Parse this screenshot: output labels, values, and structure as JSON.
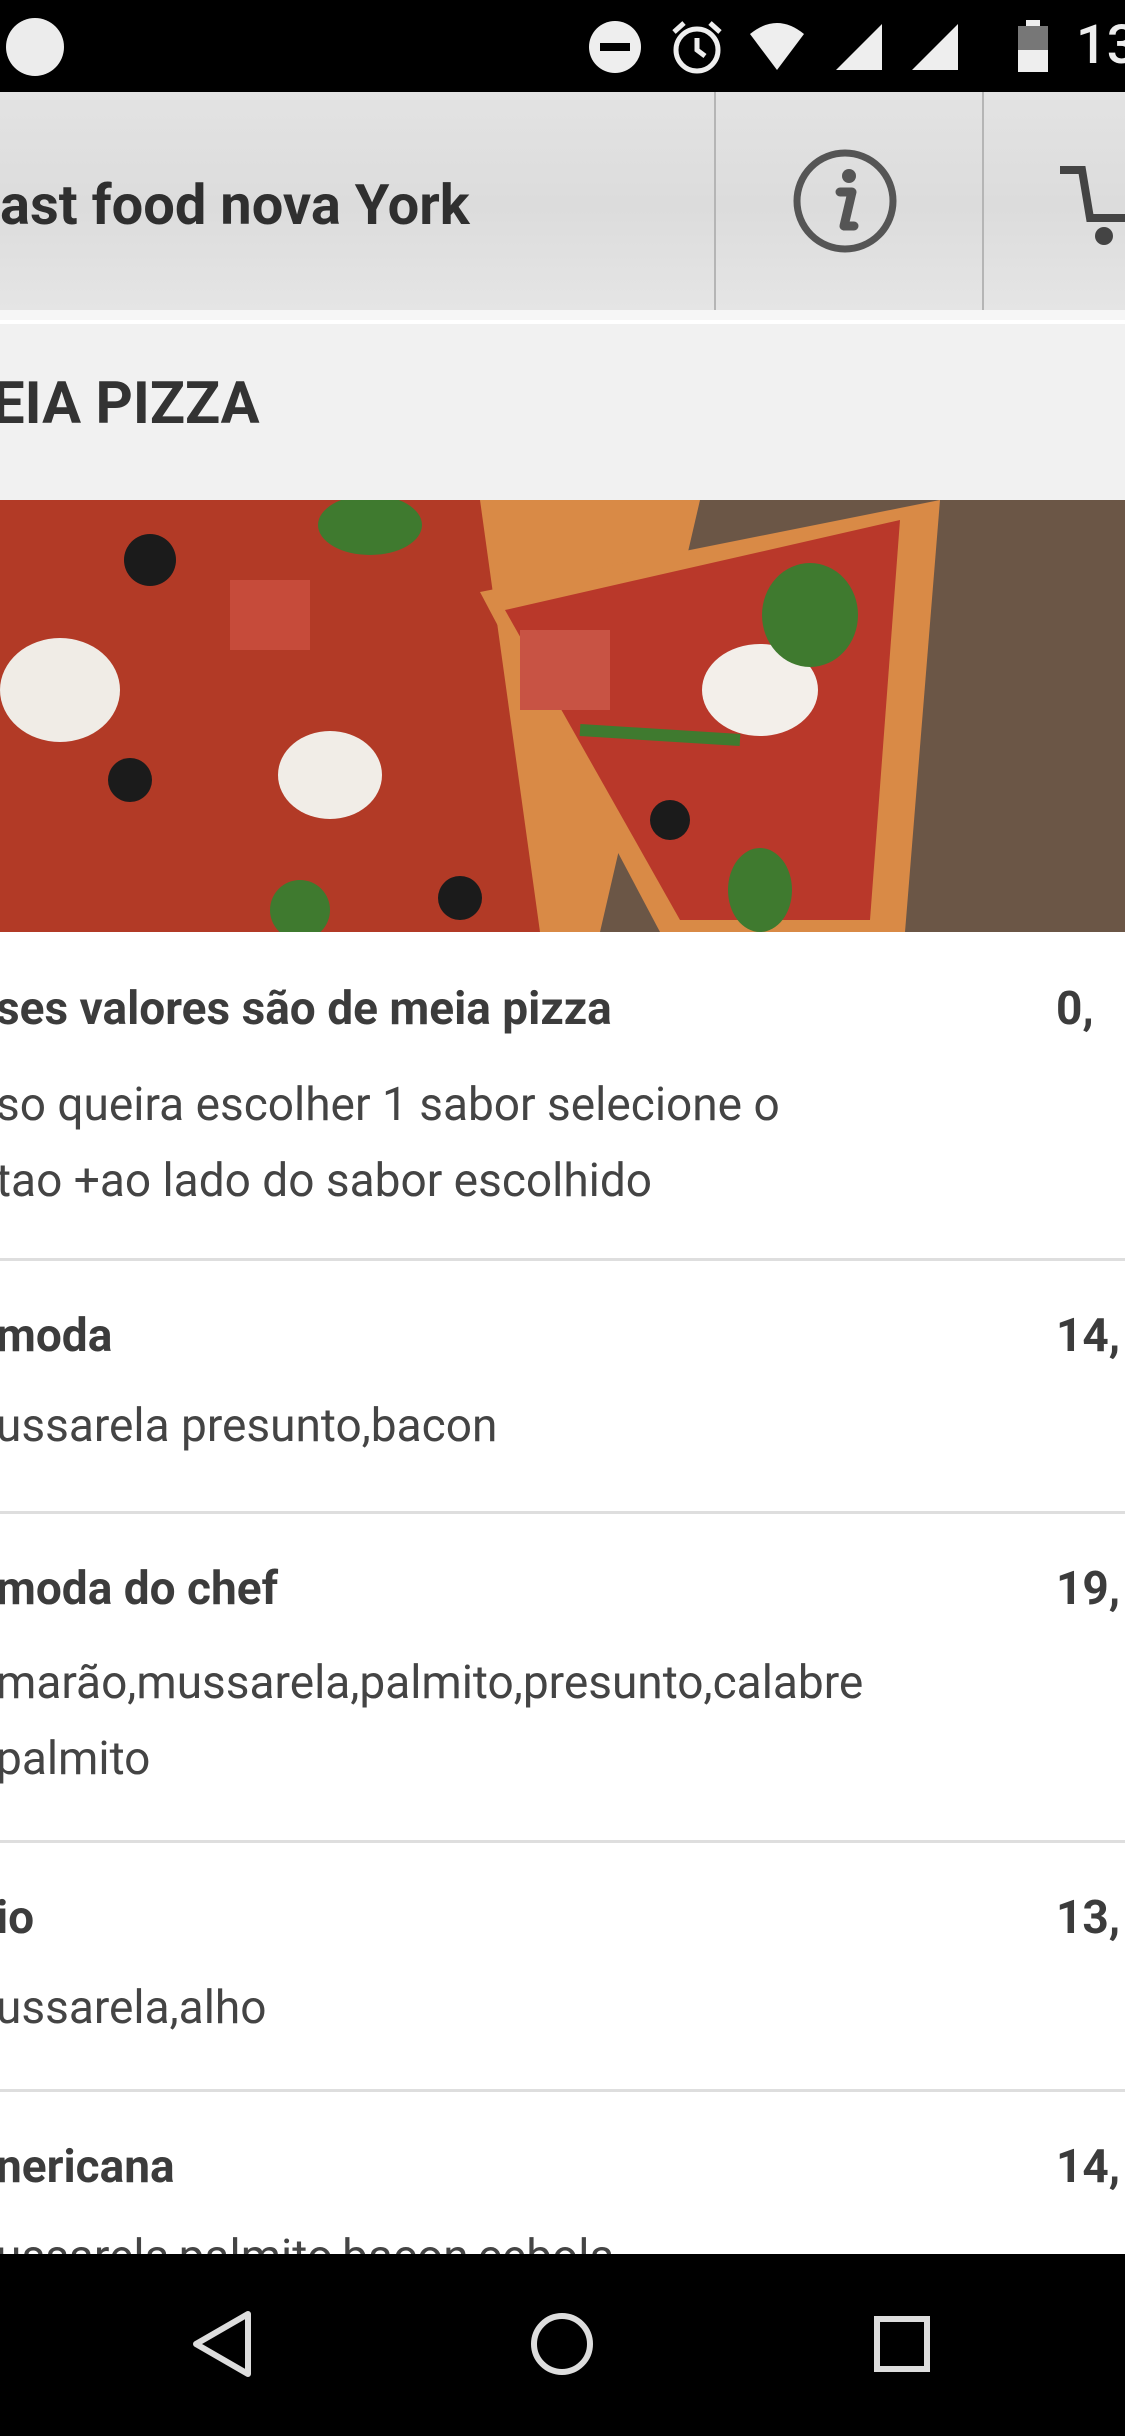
{
  "status_bar": {
    "time": "13"
  },
  "header": {
    "title": "ast food nova York"
  },
  "section": {
    "title": "EIA PIZZA"
  },
  "items": [
    {
      "name": "ses valores são de meia pizza",
      "price": "0,",
      "desc_lines": [
        "so queira escolher 1 sabor selecione o",
        "tao +ao lado do sabor escolhido"
      ]
    },
    {
      "name": "moda",
      "price": "14,",
      "desc_lines": [
        "ussarela presunto,bacon"
      ]
    },
    {
      "name": "moda do chef",
      "price": "19,",
      "desc_lines": [
        "marão,mussarela,palmito,presunto,calabre",
        "palmito"
      ]
    },
    {
      "name": "io",
      "price": "13,",
      "desc_lines": [
        "ussarela,alho"
      ]
    },
    {
      "name": "nericana",
      "price": "14,",
      "desc_lines": [
        "ussarela,palmito,bacon,cebola"
      ]
    }
  ],
  "icons": {
    "info": "info-icon",
    "cart": "cart-icon",
    "back": "back-triangle-icon",
    "home": "home-circle-icon",
    "recents": "recents-square-icon"
  }
}
